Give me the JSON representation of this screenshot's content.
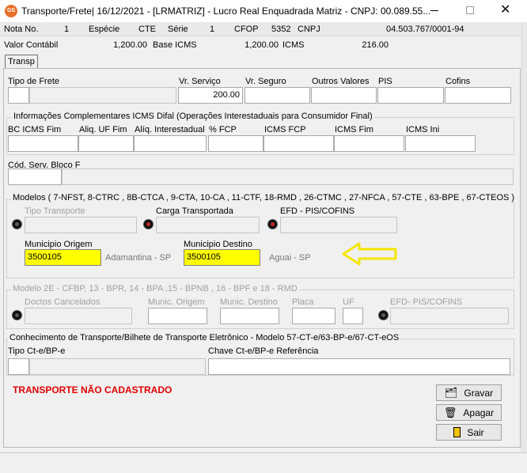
{
  "window": {
    "title": "Transporte/Frete|  16/12/2021 - [LRMATRIZ] - Lucro Real Enquadrada Matriz - CNPJ: 00.089.55...",
    "app_icon_text": "GS"
  },
  "header": {
    "nota_label": "Nota No.",
    "nota_value": "1",
    "especie_label": "Espécie",
    "especie_value": "CTE",
    "serie_label": "Série",
    "serie_value": "1",
    "cfop_label": "CFOP",
    "cfop_value": "5352",
    "cnpj_label": "CNPJ",
    "cnpj_value": "04.503.767/0001-94",
    "valor_label": "Valor Contábil",
    "valor_value": "1,200.00",
    "base_label": "Base ICMS",
    "base_value": "1,200.00",
    "icms_label": "ICMS",
    "icms_value": "216.00"
  },
  "tab": {
    "label": "Transp"
  },
  "frete": {
    "tipo_label": "Tipo de Frete",
    "servico_label": "Vr. Serviço",
    "servico_value": "200.00",
    "seguro_label": "Vr. Seguro",
    "outros_label": "Outros Valores",
    "pis_label": "PIS",
    "cofins_label": "Cofins"
  },
  "difal": {
    "title": "Informações Complementares ICMS Difal (Operações Interestaduais para Consumidor Final)",
    "bc_label": "BC ICMS Fim",
    "aliq_uf_label": "Aliq. UF Fim",
    "aliq_inter_label": "Alíq. Interestadual",
    "fcp_label": "% FCP",
    "icms_fcp_label": "ICMS FCP",
    "icms_fim_label": "ICMS Fim",
    "icms_ini_label": "ICMS Ini"
  },
  "bloco_f": {
    "label": "Cód. Serv. Bloco F"
  },
  "modelos": {
    "title": "Modelos ( 7-NFST, 8-CTRC , 8B-CTCA , 9-CTA, 10-CA , 11-CTF, 18-RMD , 26-CTMC , 27-NFCA , 57-CTE , 63-BPE , 67-CTEOS  )",
    "tipo_transporte_label": "Tipo Transporte",
    "carga_label": "Carga Transportada",
    "efd_label": "EFD - PIS/COFINS",
    "origem_label": "Municipio Origem",
    "origem_value": "3500105",
    "origem_city": "Adamantina - SP",
    "destino_label": "Municipio Destino",
    "destino_value": "3500105",
    "destino_city": "Aguai - SP"
  },
  "modelo2e": {
    "title": "Modelo 2E - CFBP, 13 - BPR, 14 - BPA ,15 - BPNB , 16 - BPF e 18 - RMD",
    "doctos_label": "Doctos Cancelados",
    "munic_origem_label": "Munic. Origem",
    "munic_destino_label": "Munic. Destino",
    "placa_label": "Placa",
    "uf_label": "UF",
    "efd_label": "EFD- PIS/COFINS"
  },
  "conhecimento": {
    "title": "Conhecimento de Transporte/Bilhete de Transporte Eletrônico - Modelo 57-CT-e/63-BP-e/67-CT-eOS",
    "tipo_label": "Tipo Ct-e/BP-e",
    "chave_label": "Chave Ct-e/BP-e Referência"
  },
  "status": {
    "message": "TRANSPORTE NÃO CADASTRADO",
    "color": "#e00000"
  },
  "buttons": {
    "gravar": "Gravar",
    "apagar": "Apagar",
    "sair": "Sair"
  },
  "colors": {
    "highlight": "#ffff00",
    "arrow": "#f5e600"
  }
}
